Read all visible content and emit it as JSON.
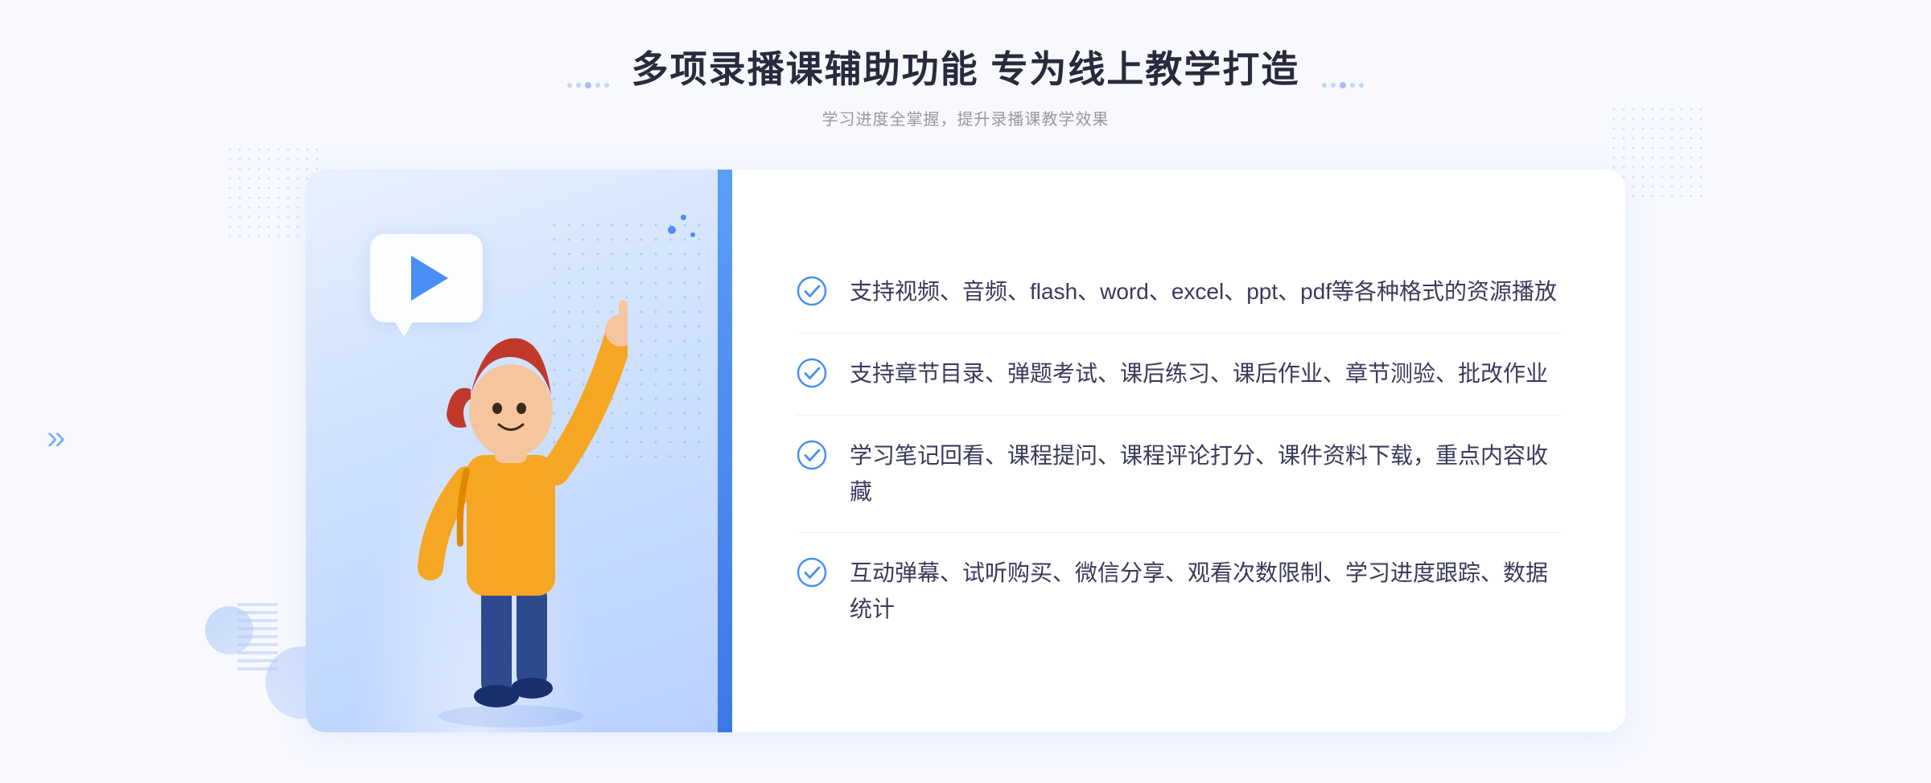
{
  "header": {
    "title": "多项录播课辅助功能 专为线上教学打造",
    "subtitle": "学习进度全掌握，提升录播课教学效果",
    "dots_left_label": "decorative-dots-left",
    "dots_right_label": "decorative-dots-right"
  },
  "features": [
    {
      "id": "feature-1",
      "text": "支持视频、音频、flash、word、excel、ppt、pdf等各种格式的资源播放"
    },
    {
      "id": "feature-2",
      "text": "支持章节目录、弹题考试、课后练习、课后作业、章节测验、批改作业"
    },
    {
      "id": "feature-3",
      "text": "学习笔记回看、课程提问、课程评论打分、课件资料下载，重点内容收藏"
    },
    {
      "id": "feature-4",
      "text": "互动弹幕、试听购买、微信分享、观看次数限制、学习进度跟踪、数据统计"
    }
  ],
  "colors": {
    "accent_blue": "#4a8ff5",
    "title_color": "#2a2a3e",
    "text_color": "#3a3a5c",
    "subtitle_color": "#999999",
    "check_color": "#4a8ff5",
    "bg_color": "#f8f9ff"
  },
  "icons": {
    "chevron_left": "«",
    "play": "▶",
    "check": "check-circle-icon"
  }
}
